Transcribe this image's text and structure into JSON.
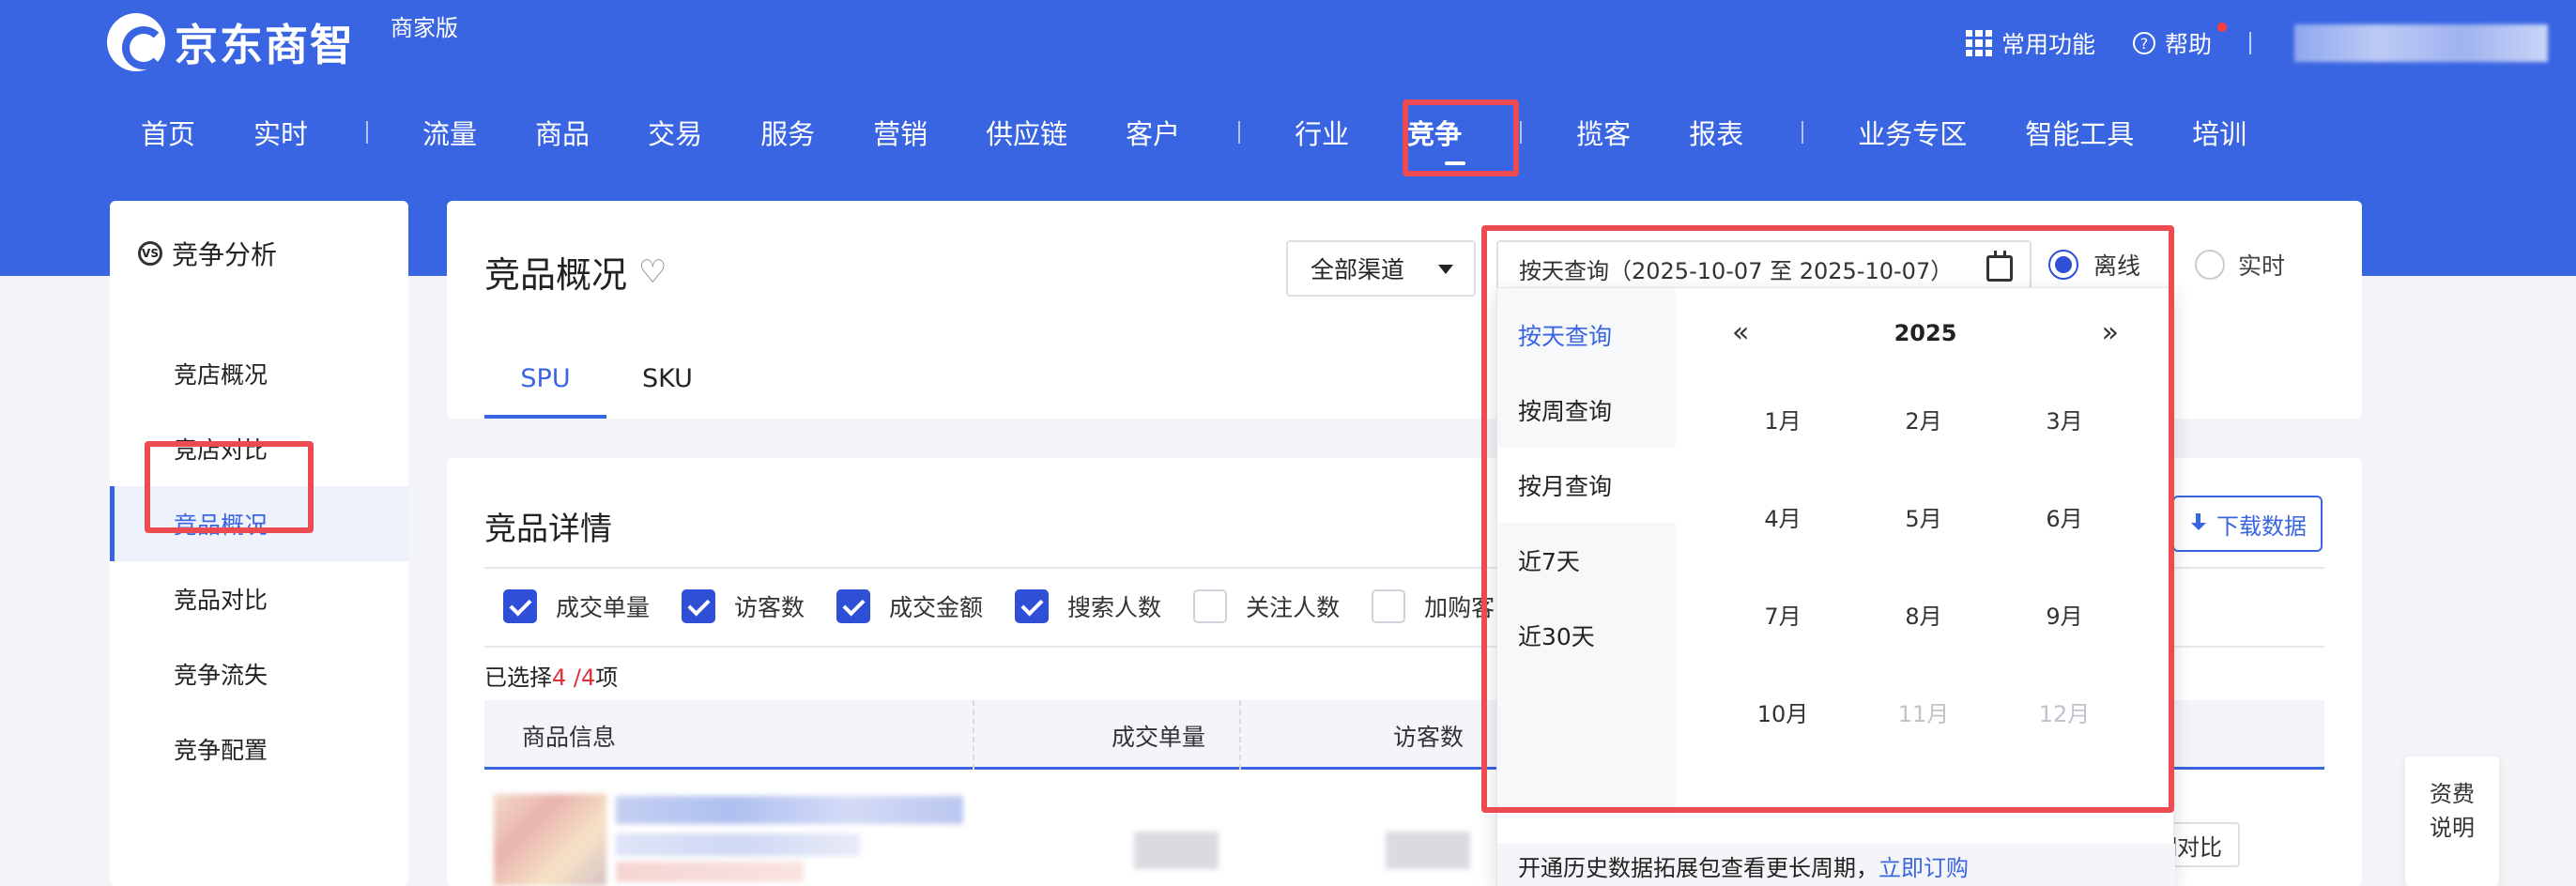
{
  "brand": {
    "name": "京东商智",
    "edition": "商家版"
  },
  "top_right": {
    "common_functions": "常用功能",
    "help": "帮助"
  },
  "nav": {
    "items": [
      "首页",
      "实时",
      "流量",
      "商品",
      "交易",
      "服务",
      "营销",
      "供应链",
      "客户",
      "行业",
      "竞争",
      "揽客",
      "报表",
      "业务专区",
      "智能工具",
      "培训"
    ],
    "active": "竞争"
  },
  "sidebar": {
    "title": "竞争分析",
    "items": [
      "竞店概况",
      "竞店对比",
      "竞品概况",
      "竞品对比",
      "竞争流失",
      "竞争配置"
    ],
    "active": "竞品概况"
  },
  "page": {
    "title": "竞品概况",
    "channel": "全部渠道",
    "tabs": [
      "SPU",
      "SKU"
    ],
    "active_tab": "SPU",
    "date_range": "按天查询（2025-10-07 至 2025-10-07）",
    "mode_offline": "离线",
    "mode_realtime": "实时"
  },
  "detail": {
    "title": "竞品详情",
    "download": "下载数据",
    "metrics": [
      {
        "label": "成交单量",
        "checked": true
      },
      {
        "label": "访客数",
        "checked": true
      },
      {
        "label": "成交金额",
        "checked": true
      },
      {
        "label": "搜索人数",
        "checked": true
      },
      {
        "label": "关注人数",
        "checked": false
      },
      {
        "label": "加购客",
        "checked": false
      }
    ],
    "selected_prefix": "已选择",
    "selected_count": "4",
    "selected_sep": " /",
    "selected_total": "4",
    "selected_suffix": "项",
    "columns": [
      "商品信息",
      "成交单量",
      "访客数"
    ],
    "row_action": "细对比"
  },
  "picker": {
    "quick": [
      "按天查询",
      "按周查询",
      "按月查询",
      "近7天",
      "近30天"
    ],
    "active_quick": "按天查询",
    "year": "2025",
    "months": [
      "1月",
      "2月",
      "3月",
      "4月",
      "5月",
      "6月",
      "7月",
      "8月",
      "9月",
      "10月",
      "11月",
      "12月"
    ],
    "disabled_months": [
      "11月",
      "12月"
    ],
    "footer_text": "开通历史数据拓展包查看更长周期，",
    "footer_link": "立即订购"
  },
  "fee": {
    "line1": "资费",
    "line2": "说明"
  },
  "colors": {
    "brand_blue": "#3a65e2",
    "highlight_red": "#ee4a52",
    "checkbox_blue": "#2f4fd6"
  }
}
